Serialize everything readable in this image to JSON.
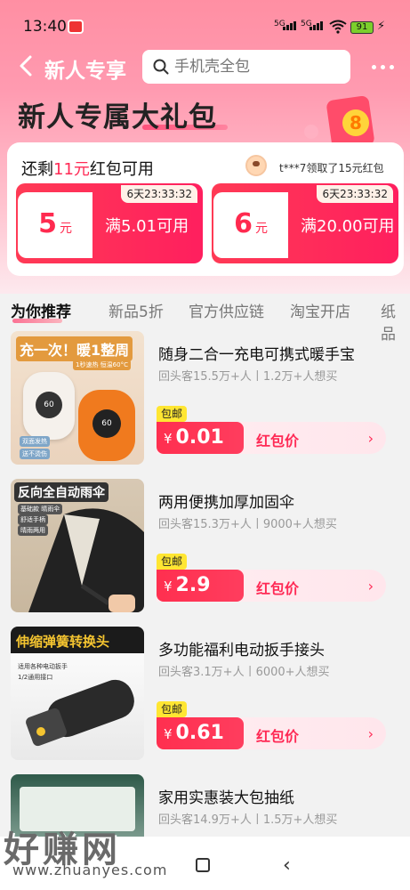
{
  "status_bar": {
    "time": "13:40",
    "net1": "5G",
    "net2": "5G",
    "battery": "91"
  },
  "nav": {
    "title": "新人专享",
    "search_placeholder": "手机壳全包"
  },
  "banner": {
    "title": "新人专属大礼包"
  },
  "coupon_card": {
    "remain_prefix": "还剩",
    "remain_amount": "11元",
    "remain_suffix": "红包可用",
    "notice": "t***7领取了15元红包",
    "coupons": [
      {
        "value": "5",
        "unit": "元",
        "condition": "满5.01可用",
        "timer": "6天23:33:32"
      },
      {
        "value": "6",
        "unit": "元",
        "condition": "满20.00可用",
        "timer": "6天23:33:32"
      }
    ]
  },
  "tabs": [
    "为你推荐",
    "新品5折",
    "官方供应链",
    "淘宝开店",
    "纸品"
  ],
  "products": [
    {
      "title": "随身二合一充电可携式暖手宝",
      "stats": "回头客15.5万+人丨1.2万+人想买",
      "tag": "包邮",
      "currency": "¥",
      "price": "0.01",
      "label": "红包价",
      "img_text": "充一次！暖1整周",
      "img_sub": "1秒速热 恒温60°C",
      "img_chips": "双面发热",
      "img_chips2": "送不烫伤",
      "img_num": "60"
    },
    {
      "title": "两用便携加厚加固伞",
      "stats": "回头客15.3万+人丨9000+人想买",
      "tag": "包邮",
      "currency": "¥",
      "price": "2.9",
      "label": "红包价",
      "img_text": "反向全自动雨伞",
      "img_chips": "基础款 晴雨伞",
      "img_chips2": "舒适手柄",
      "img_chips3": "晴雨两用"
    },
    {
      "title": "多功能福利电动扳手接头",
      "stats": "回头客3.1万+人丨6000+人想买",
      "tag": "包邮",
      "currency": "¥",
      "price": "0.61",
      "label": "红包价",
      "img_text": "伸缩弹簧转换头",
      "img_chips": "适用各种电动扳手",
      "img_chips2": "1/2通用接口"
    },
    {
      "title": "家用实惠装大包抽纸",
      "stats": "回头客14.9万+人丨1.5万+人想买"
    }
  ],
  "watermark": {
    "text": "好赚网",
    "url": "www.zhuanyes.com"
  }
}
